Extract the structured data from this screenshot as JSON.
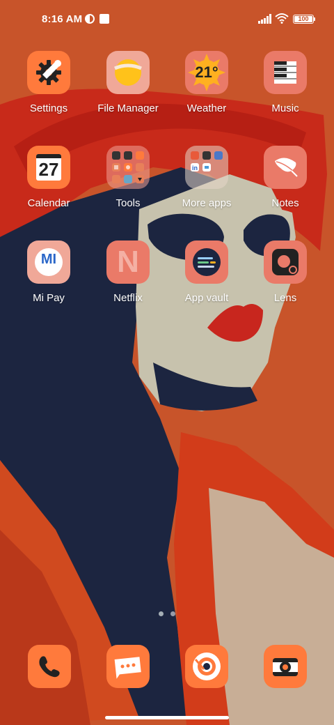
{
  "status_bar": {
    "time": "8:16 AM",
    "battery": "100"
  },
  "apps": [
    {
      "label": "Settings",
      "icon": "gear-wrench-icon"
    },
    {
      "label": "File Manager",
      "icon": "folder-sun-icon"
    },
    {
      "label": "Weather",
      "icon": "sun-icon",
      "temp": "21°"
    },
    {
      "label": "Music",
      "icon": "piano-keys-icon"
    },
    {
      "label": "Calendar",
      "icon": "calendar-icon",
      "day": "27"
    },
    {
      "label": "Tools",
      "icon": "tools-folder-icon"
    },
    {
      "label": "More apps",
      "icon": "more-apps-folder-icon"
    },
    {
      "label": "Notes",
      "icon": "feather-icon"
    },
    {
      "label": "Mi Pay",
      "icon": "mi-pay-icon",
      "logo_text": "MI"
    },
    {
      "label": "Netflix",
      "icon": "netflix-icon",
      "logo_text": "N"
    },
    {
      "label": "App vault",
      "icon": "app-vault-icon"
    },
    {
      "label": "Lens",
      "icon": "lens-icon"
    }
  ],
  "dock": [
    {
      "name": "phone",
      "icon": "phone-icon"
    },
    {
      "name": "messages",
      "icon": "message-icon"
    },
    {
      "name": "chrome",
      "icon": "chrome-icon"
    },
    {
      "name": "camera",
      "icon": "camera-icon"
    }
  ],
  "page_indicator": {
    "pages": 2,
    "current": 1
  },
  "colors": {
    "wallpaper_base": "#c8542a",
    "icon_orange": "#ff7a3c",
    "icon_pink": "#ea7a68",
    "navy": "#1c2540"
  }
}
